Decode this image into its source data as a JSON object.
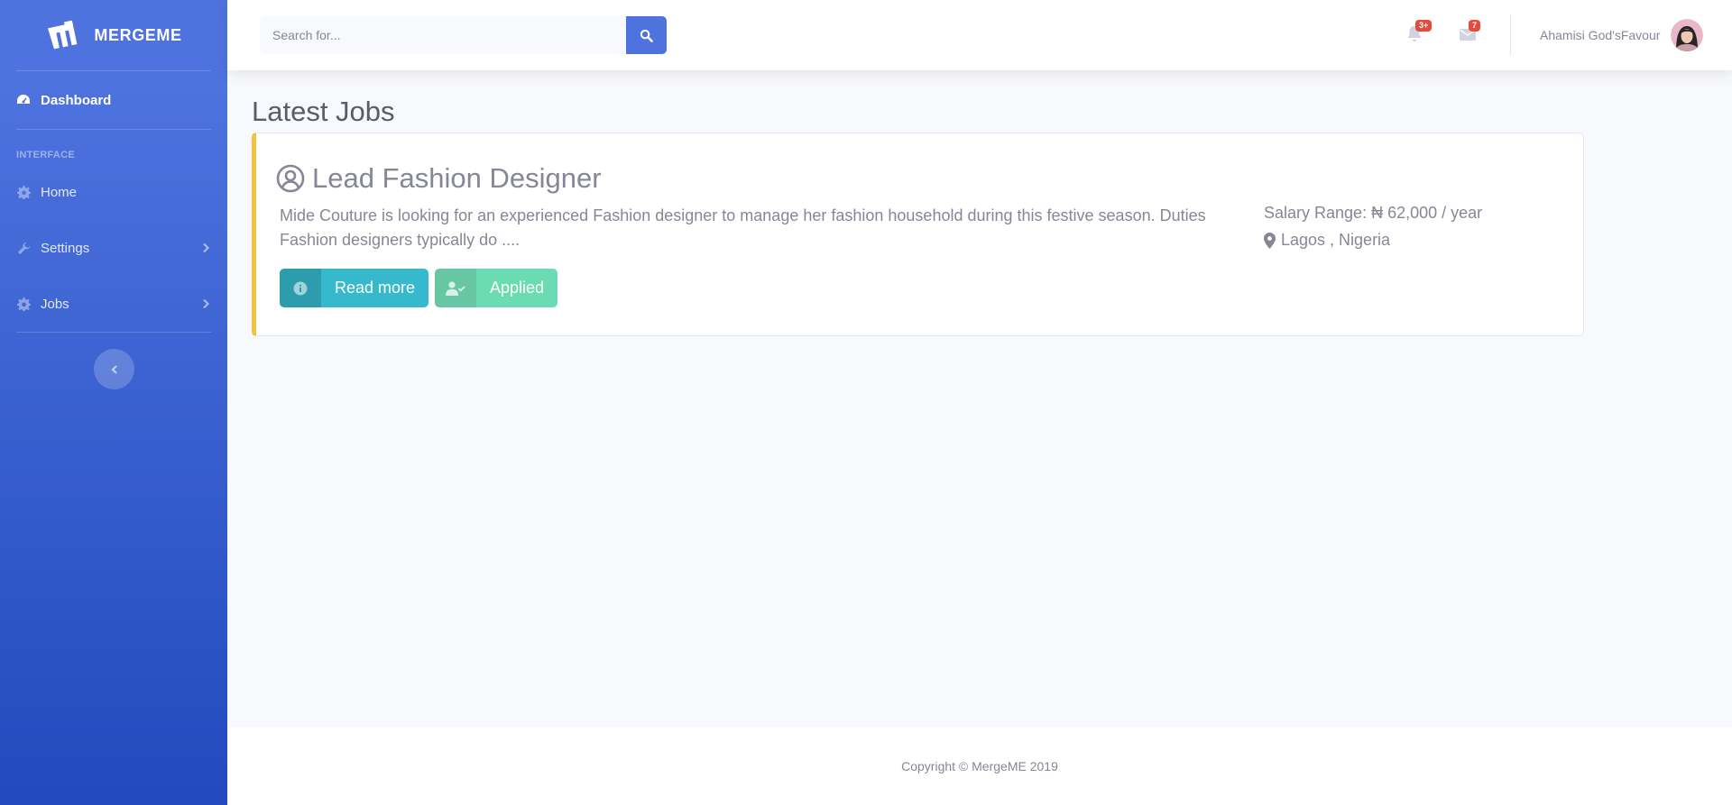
{
  "brand": {
    "name": "MERGEME",
    "icon": "mergeme-logo"
  },
  "sidebar": {
    "dashboard": {
      "label": "Dashboard",
      "icon": "tachometer-icon"
    },
    "heading": "Interface",
    "items": [
      {
        "label": "Home",
        "icon": "cog-icon",
        "has_submenu": false
      },
      {
        "label": "Settings",
        "icon": "wrench-icon",
        "has_submenu": true
      },
      {
        "label": "Jobs",
        "icon": "cog-icon",
        "has_submenu": true
      }
    ],
    "toggle_icon": "chevron-left-icon"
  },
  "topbar": {
    "search_placeholder": "Search for...",
    "alerts_badge": "3+",
    "messages_badge": "7",
    "user_name": "Ahamisi God'sFavour"
  },
  "main": {
    "title": "Latest Jobs",
    "job": {
      "title": "Lead Fashion Designer",
      "description": "Mide Couture is looking for an experienced Fashion designer to manage her fashion household during this festive season. Duties Fashion designers typically do ....",
      "salary": "Salary Range: ₦ 62,000 / year",
      "location": "Lagos , Nigeria",
      "read_more": "Read more",
      "applied": "Applied"
    }
  },
  "footer": {
    "copyright": "Copyright © MergeME 2019"
  },
  "colors": {
    "primary": "#4e73df",
    "info": "#36b9cc",
    "success": "#1cc88a",
    "warning": "#f6c23e",
    "danger": "#e74a3b"
  }
}
